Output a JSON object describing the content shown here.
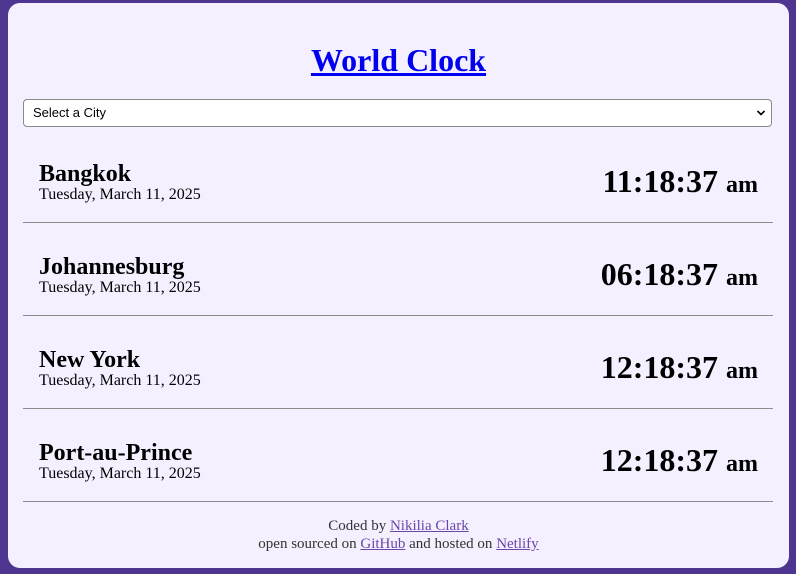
{
  "page": {
    "title": "World Clock"
  },
  "select": {
    "selected": "Select a City"
  },
  "cities": [
    {
      "name": "Bangkok",
      "date": "Tuesday, March 11, 2025",
      "time": "11:18:37",
      "ampm": "am"
    },
    {
      "name": "Johannesburg",
      "date": "Tuesday, March 11, 2025",
      "time": "06:18:37",
      "ampm": "am"
    },
    {
      "name": "New York",
      "date": "Tuesday, March 11, 2025",
      "time": "12:18:37",
      "ampm": "am"
    },
    {
      "name": "Port-au-Prince",
      "date": "Tuesday, March 11, 2025",
      "time": "12:18:37",
      "ampm": "am"
    }
  ],
  "footer": {
    "coded_by": "Coded by",
    "author": "Nikilia Clark",
    "open_sourced": "open sourced on",
    "github": "GitHub",
    "hosted": "and hosted on",
    "netlify": "Netlify"
  },
  "colors": {
    "background": "#4d3590",
    "card": "#f5f0ff",
    "title_link": "#0000ee",
    "footer_link": "#6a46a8"
  }
}
